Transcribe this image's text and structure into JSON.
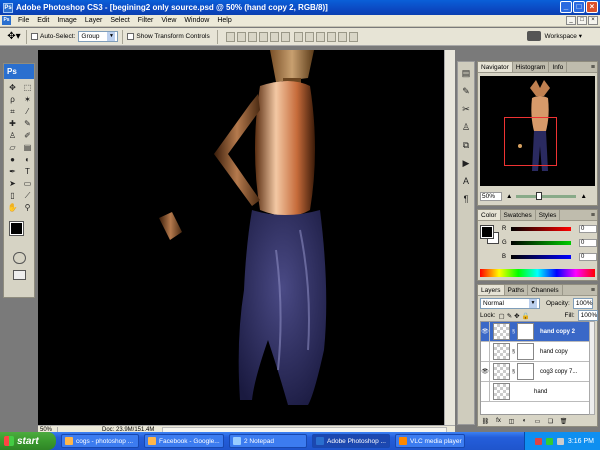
{
  "window": {
    "app_icon": "Ps",
    "title": "Adobe Photoshop CS3 - [begining2 only source.psd @ 50% (hand copy 2, RGB/8)]",
    "controls": [
      "_",
      "□",
      "×"
    ]
  },
  "menubar": {
    "items": [
      "File",
      "Edit",
      "Image",
      "Layer",
      "Select",
      "Filter",
      "View",
      "Window",
      "Help"
    ]
  },
  "options": {
    "auto_select_label": "Auto-Select:",
    "auto_select_value": "Group",
    "transform_label": "Show Transform Controls",
    "workspace_label": "Workspace ▾"
  },
  "toolbox": {
    "logo": "Ps",
    "tools": [
      "move-icon",
      "marquee-icon",
      "lasso-icon",
      "magic-wand-icon",
      "crop-icon",
      "slice-icon",
      "heal-icon",
      "brush-icon",
      "stamp-icon",
      "history-brush-icon",
      "eraser-icon",
      "gradient-icon",
      "blur-icon",
      "dodge-icon",
      "pen-icon",
      "type-icon",
      "path-select-icon",
      "shape-icon",
      "notes-icon",
      "eyedropper-icon",
      "hand-icon",
      "zoom-icon"
    ],
    "foreground_color": "#000000",
    "background_color": "#ffffff"
  },
  "status": {
    "zoom": "50%",
    "doc_info": "Doc: 23.9M/151.4M"
  },
  "navigator": {
    "tabs": [
      "Navigator",
      "Histogram",
      "Info"
    ],
    "zoom": "50%"
  },
  "color_panel": {
    "tabs": [
      "Color",
      "Swatches",
      "Styles"
    ],
    "channels": [
      {
        "label": "R",
        "value": "0"
      },
      {
        "label": "G",
        "value": "0"
      },
      {
        "label": "B",
        "value": "0"
      }
    ]
  },
  "layers_panel": {
    "tabs": [
      "Layers",
      "Paths",
      "Channels"
    ],
    "blend_mode": "Normal",
    "opacity_label": "Opacity:",
    "opacity_value": "100%",
    "lock_label": "Lock:",
    "fill_label": "Fill:",
    "fill_value": "100%",
    "layers": [
      {
        "name": "hand copy 2",
        "visible": true,
        "selected": true
      },
      {
        "name": "hand copy",
        "visible": false,
        "selected": false
      },
      {
        "name": "cog3 copy 7...",
        "visible": true,
        "selected": false
      },
      {
        "name": "hand",
        "visible": false,
        "selected": false
      }
    ]
  },
  "taskbar": {
    "start_label": "start",
    "items": [
      {
        "label": "cogs - photoshop ...",
        "active": false
      },
      {
        "label": "Facebook - Google...",
        "active": false
      },
      {
        "label": "2 Notepad",
        "active": false
      },
      {
        "label": "Adobe Photoshop ...",
        "active": true
      },
      {
        "label": "VLC media player",
        "active": false
      }
    ],
    "clock": "3:16 PM"
  }
}
